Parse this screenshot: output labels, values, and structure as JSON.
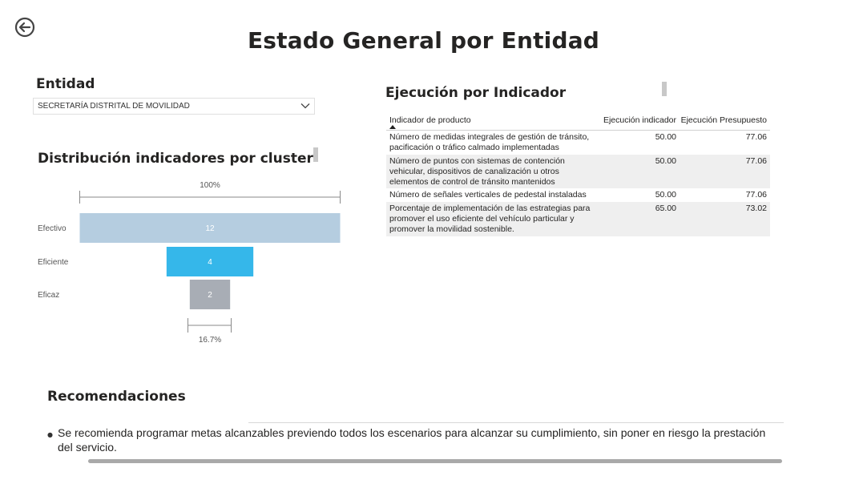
{
  "page": {
    "title": "Estado General por Entidad"
  },
  "icons": {
    "back": "back-arrow-circle-icon",
    "dropdown": "chevron-down-icon",
    "sort": "sort-ascending-icon"
  },
  "entity_filter": {
    "label": "Entidad",
    "selected": "SECRETARÍA DISTRITAL DE MOVILIDAD"
  },
  "funnel": {
    "title": "Distribución indicadores por cluster",
    "top_percent_label": "100%",
    "bottom_percent_label": "16.7%"
  },
  "chart_data": {
    "type": "bar",
    "title": "Distribución indicadores por cluster",
    "categories": [
      "Efectivo",
      "Eficiente",
      "Eficaz"
    ],
    "values": [
      12,
      4,
      2
    ],
    "colors": [
      "#b5cde0",
      "#35b7ea",
      "#a8adb5"
    ],
    "annotations": [
      "100%",
      "16.7%"
    ]
  },
  "indicator_table": {
    "title": "Ejecución por Indicador",
    "columns": [
      "Indicador de producto",
      "Ejecución indicador",
      "Ejecución Presupuesto"
    ],
    "rows": [
      {
        "indicator": "Número de medidas integrales de gestión de tránsito, pacificación o tráfico calmado implementadas",
        "ejecucion_indicador": "50.00",
        "ejecucion_presupuesto": "77.06"
      },
      {
        "indicator": "Número de puntos con sistemas de contención vehicular, dispositivos de canalización u otros elementos de control de tránsito mantenidos",
        "ejecucion_indicador": "50.00",
        "ejecucion_presupuesto": "77.06"
      },
      {
        "indicator": "Número de señales verticales de pedestal instaladas",
        "ejecucion_indicador": "50.00",
        "ejecucion_presupuesto": "77.06"
      },
      {
        "indicator": "Porcentaje de implementación de las estrategias para promover el uso eficiente del vehículo particular y promover la movilidad sostenible.",
        "ejecucion_indicador": "65.00",
        "ejecucion_presupuesto": "73.02"
      }
    ]
  },
  "recommendations": {
    "title": "Recomendaciones",
    "items": [
      "Se recomienda programar metas alcanzables previendo todos los escenarios para alcanzar su cumplimiento, sin poner en riesgo la prestación del servicio."
    ]
  }
}
